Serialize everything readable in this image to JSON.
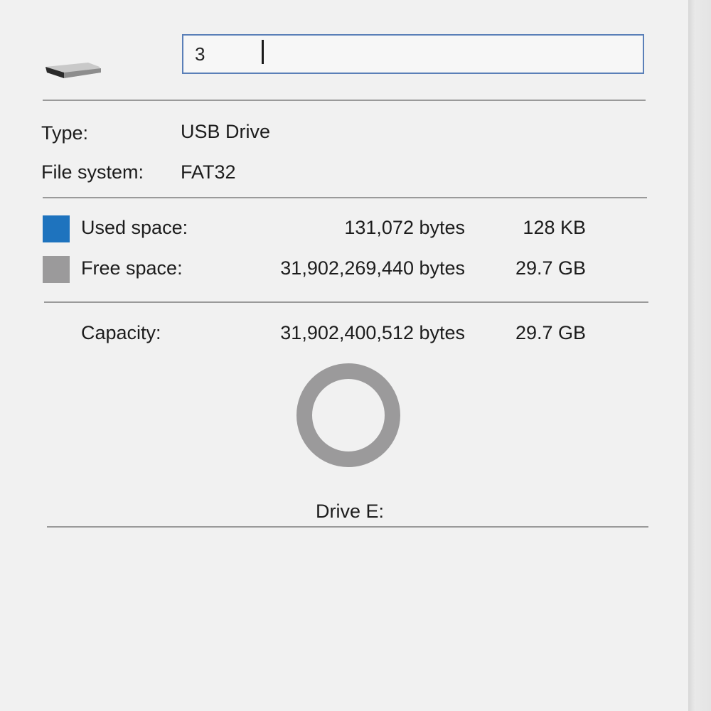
{
  "drive": {
    "name_value": "3",
    "icon": "usb-drive-icon"
  },
  "info": {
    "type_label": "Type:",
    "type_value": "USB Drive",
    "fs_label": "File system:",
    "fs_value": "FAT32"
  },
  "usage": {
    "used": {
      "label": "Used space:",
      "bytes": "131,072 bytes",
      "size": "128 KB",
      "color": "#1e73be"
    },
    "free": {
      "label": "Free space:",
      "bytes": "31,902,269,440 bytes",
      "size": "29.7 GB",
      "color": "#9b9a9b"
    },
    "capacity": {
      "label": "Capacity:",
      "bytes": "31,902,400,512 bytes",
      "size": "29.7 GB"
    }
  },
  "chart_data": {
    "type": "pie",
    "categories": [
      "Used space",
      "Free space"
    ],
    "values": [
      131072,
      31902269440
    ],
    "colors": [
      "#1e73be",
      "#9b9a9b"
    ]
  },
  "drive_label": "Drive E:"
}
